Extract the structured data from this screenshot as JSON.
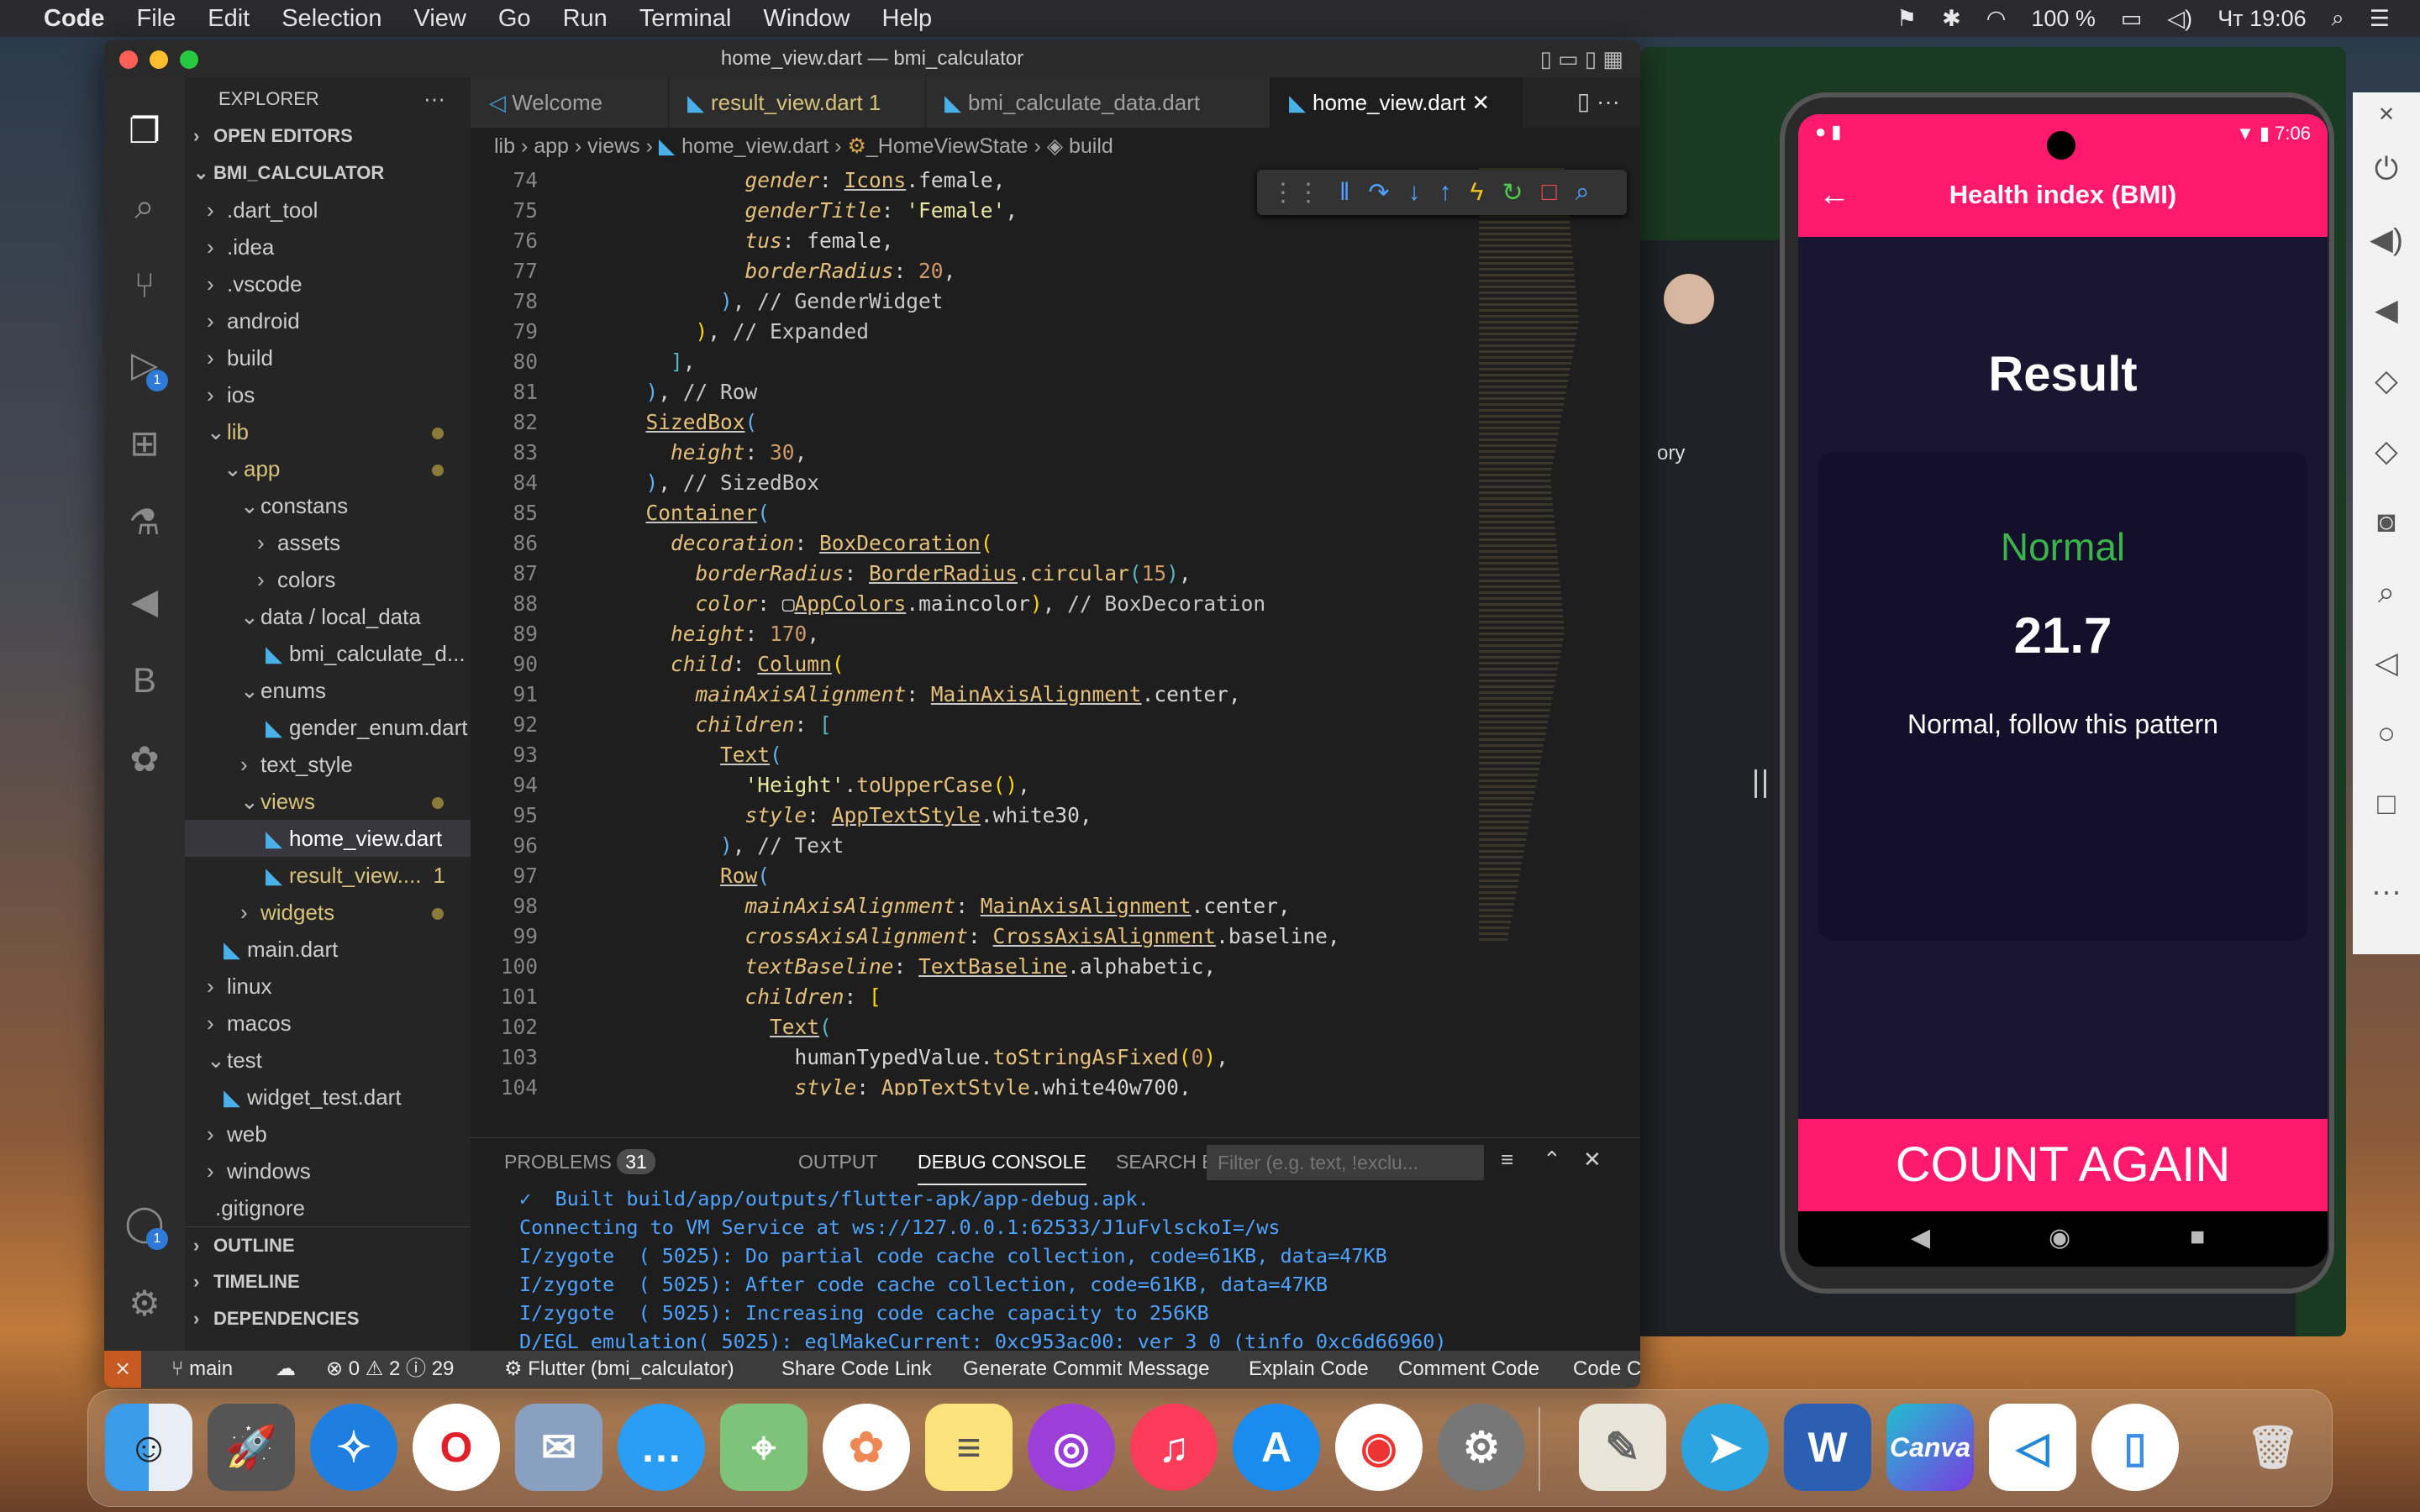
{
  "menubar": {
    "app": "Code",
    "items": [
      "File",
      "Edit",
      "Selection",
      "View",
      "Go",
      "Run",
      "Terminal",
      "Window",
      "Help"
    ],
    "battery": "100 %",
    "lang": "Чт",
    "time": "19:06"
  },
  "window": {
    "title": "home_view.dart — bmi_calculator"
  },
  "explorer": {
    "title": "EXPLORER",
    "open_editors": "OPEN EDITORS",
    "project": "BMI_CALCULATOR",
    "outline": "OUTLINE",
    "timeline": "TIMELINE",
    "dependencies": "DEPENDENCIES",
    "items": [
      ".dart_tool",
      ".idea",
      ".vscode",
      "android",
      "build",
      "ios",
      "lib",
      "app",
      "constans",
      "assets",
      "colors",
      "data",
      "local_data",
      "bmi_calculate_d...",
      "enums",
      "gender_enum.dart",
      "text_style",
      "views",
      "home_view.dart",
      "result_view....",
      "widgets",
      "main.dart",
      "linux",
      "macos",
      "test",
      "widget_test.dart",
      "web",
      "windows",
      ".gitignore"
    ],
    "result_badge": "1"
  },
  "tabs": [
    "Welcome",
    "result_view.dart 1",
    "bmi_calculate_data.dart",
    "home_view.dart"
  ],
  "breadcrumb": [
    "lib",
    "app",
    "views",
    "home_view.dart",
    "_HomeViewState",
    "build"
  ],
  "code": {
    "line_numbers": [
      "74",
      "75",
      "76",
      "77",
      "78",
      "79",
      "80",
      "81",
      "82",
      "83",
      "84",
      "85",
      "86",
      "87",
      "88",
      "89",
      "90",
      "91",
      "92",
      "93",
      "94",
      "95",
      "96",
      "97",
      "98",
      "99",
      "100",
      "101",
      "102",
      "103",
      "104"
    ]
  },
  "panel": {
    "tabs": [
      "PROBLEMS",
      "OUTPUT",
      "DEBUG CONSOLE",
      "SEARCH ERROR"
    ],
    "problems_count": "31",
    "filter_placeholder": "Filter (e.g. text, !exclu...",
    "log": [
      "✓  Built build/app/outputs/flutter-apk/app-debug.apk.",
      "Connecting to VM Service at ws://127.0.0.1:62533/J1uFvlsckoI=/ws",
      "I/zygote  ( 5025): Do partial code cache collection, code=61KB, data=47KB",
      "I/zygote  ( 5025): After code cache collection, code=61KB, data=47KB",
      "I/zygote  ( 5025): Increasing code cache capacity to 256KB",
      "D/EGL_emulation( 5025): eglMakeCurrent: 0xc953ac00: ver 3 0 (tinfo 0xc6d66960)"
    ]
  },
  "statusbar": {
    "branch": "main",
    "errors": "0",
    "warnings": "2",
    "info": "29",
    "items": [
      "Flutter (bmi_calculator)",
      "Share Code Link",
      "Generate Commit Message",
      "Explain Code",
      "Comment Code",
      "Code C"
    ]
  },
  "phone": {
    "time": "7:06",
    "appbar": "Health index  (BMI)",
    "result_title": "Result",
    "status": "Normal",
    "bmi": "21.7",
    "advice": "Normal, follow this pattern",
    "button": "COUNT AGAIN"
  },
  "background": {
    "partial_text": "ory"
  },
  "colors": {
    "accent": "#ff1a6e",
    "vscode_bg": "#1e1e1e",
    "normal_green": "#3bb54a"
  }
}
